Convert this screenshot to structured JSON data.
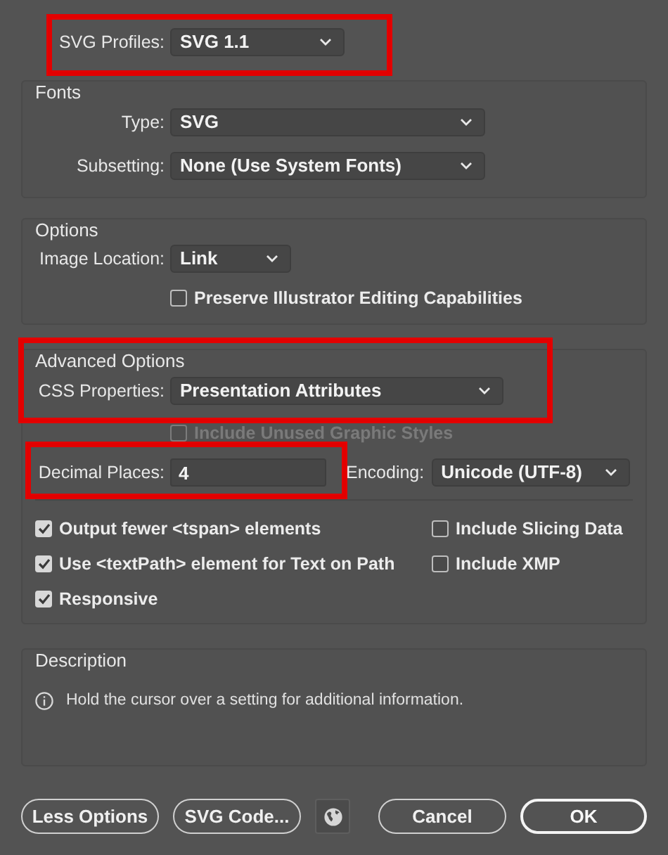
{
  "profile": {
    "label": "SVG Profiles:",
    "value": "SVG 1.1",
    "highlighted": true
  },
  "fonts": {
    "title": "Fonts",
    "rows": [
      {
        "label": "Type:",
        "value": "SVG"
      },
      {
        "label": "Subsetting:",
        "value": "None (Use System Fonts)"
      }
    ]
  },
  "options": {
    "title": "Options",
    "image_location": {
      "label": "Image Location:",
      "value": "Link"
    },
    "preserve": {
      "label": "Preserve Illustrator Editing Capabilities",
      "checked": false,
      "disabled": false
    }
  },
  "advanced": {
    "title": "Advanced Options",
    "highlighted": true,
    "css": {
      "label": "CSS Properties:",
      "value": "Presentation Attributes"
    },
    "unused_styles": {
      "label": "Include Unused Graphic Styles",
      "checked": false,
      "disabled": true
    },
    "decimal": {
      "label": "Decimal Places:",
      "value": "4",
      "highlighted": true
    },
    "encoding": {
      "label": "Encoding:",
      "value": "Unicode (UTF-8)"
    },
    "left_checks": [
      {
        "label": "Output fewer <tspan> elements",
        "checked": true
      },
      {
        "label": "Use <textPath> element for Text on Path",
        "checked": true
      },
      {
        "label": "Responsive",
        "checked": true
      }
    ],
    "right_checks": [
      {
        "label": "Include Slicing Data",
        "checked": false
      },
      {
        "label": "Include XMP",
        "checked": false
      }
    ]
  },
  "description": {
    "title": "Description",
    "text": "Hold the cursor over a setting for additional information."
  },
  "buttons": [
    {
      "label": "Less Options",
      "kind": "text"
    },
    {
      "label": "SVG Code...",
      "kind": "text"
    },
    {
      "kind": "globe"
    },
    {
      "label": "Cancel",
      "kind": "text"
    },
    {
      "label": "OK",
      "kind": "default"
    }
  ]
}
